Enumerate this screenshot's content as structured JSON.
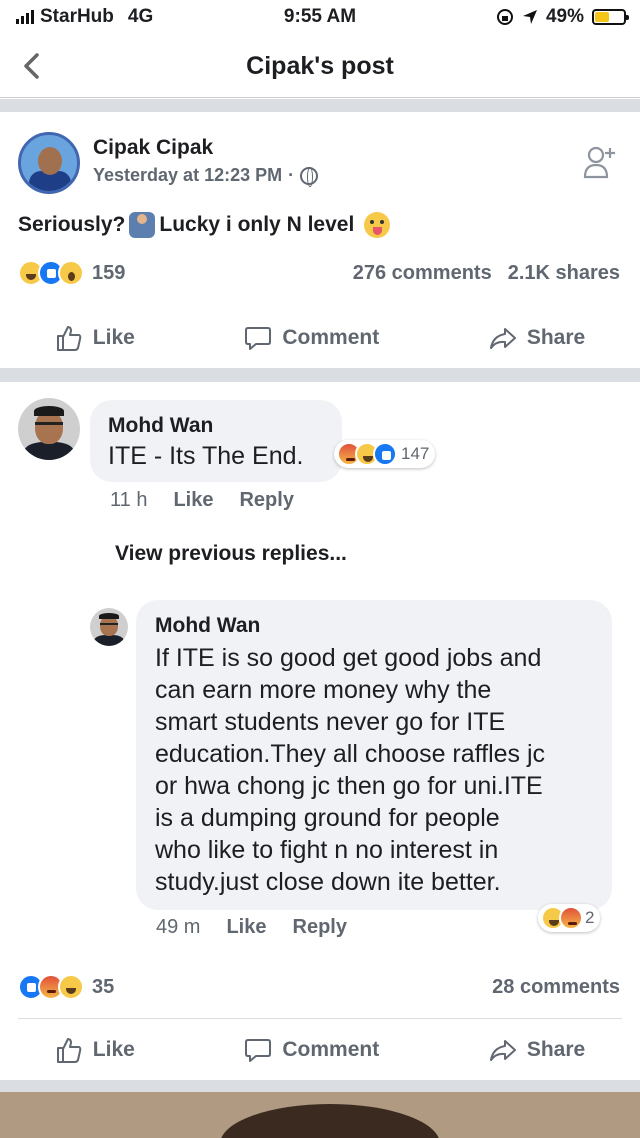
{
  "status_bar": {
    "carrier": "StarHub",
    "network": "4G",
    "time": "9:55 AM",
    "battery": "49%",
    "battery_level": 0.49
  },
  "nav": {
    "title": "Cipak's post"
  },
  "post": {
    "author": "Cipak Cipak",
    "timestamp": "Yesterday at 12:23 PM",
    "separator": "·",
    "text_part1": "Seriously?",
    "text_part2": "Lucky i only N level",
    "reactions": [
      "haha",
      "like",
      "wow"
    ],
    "reaction_count": "159",
    "comments": "276 comments",
    "shares": "2.1K shares"
  },
  "actions": {
    "like": "Like",
    "comment": "Comment",
    "share": "Share"
  },
  "comment": {
    "author": "Mohd Wan",
    "text": "ITE - Its The End.",
    "reactions": [
      "angry",
      "haha",
      "like"
    ],
    "reaction_count": "147",
    "time": "11 h",
    "like": "Like",
    "reply": "Reply"
  },
  "view_previous": "View previous replies...",
  "reply": {
    "author": "Mohd Wan",
    "lines": [
      "If ITE is so good get good jobs and",
      "can earn more money why the",
      "smart students never go for ITE",
      "education.They all choose raffles jc",
      "or hwa chong jc then go for uni.ITE",
      "is a dumping ground for people",
      "who like to fight n no interest in",
      "study.just close down ite better."
    ],
    "time": "49 m",
    "like": "Like",
    "reply": "Reply",
    "reactions": [
      "haha",
      "angry"
    ],
    "reaction_count": "2"
  },
  "comment_summary": {
    "reactions": [
      "like",
      "angry",
      "haha"
    ],
    "reaction_count": "35",
    "comments": "28 comments"
  },
  "colors": {
    "accent": "#1877f2",
    "secondary_text": "#606770",
    "bubble": "#f0f2f5",
    "separator": "#dadde1"
  }
}
